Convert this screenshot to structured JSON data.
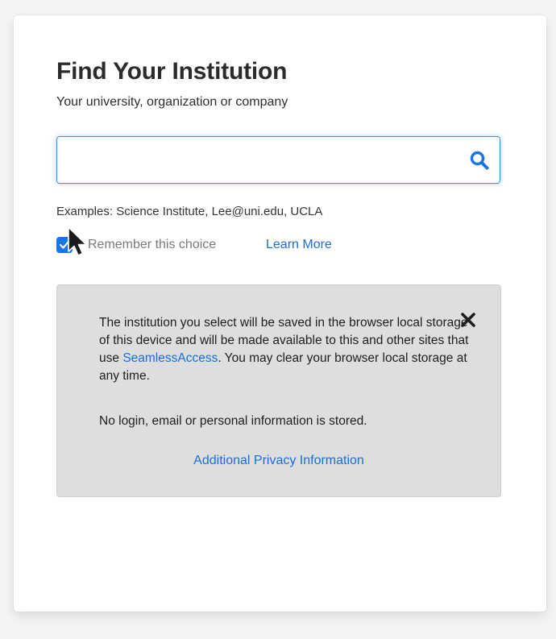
{
  "header": {
    "title": "Find Your Institution",
    "subtitle": "Your university, organization or company"
  },
  "search": {
    "value": "",
    "placeholder": "",
    "icon": "search-icon"
  },
  "examples": "Examples: Science Institute, Lee@uni.edu, UCLA",
  "remember": {
    "label": "Remember this choice",
    "checked": true,
    "learn_more": "Learn More"
  },
  "info_panel": {
    "text_before_link": "The institution you select will be saved in the browser local storage of this device and will be made available to this and other sites that use ",
    "link_text": "SeamlessAccess",
    "text_after_link": ". You may clear your browser local storage at any time.",
    "secondary_text": "No login, email or personal information is stored.",
    "privacy_link": "Additional Privacy Information",
    "close_icon": "close-icon"
  },
  "colors": {
    "accent": "#1a6ed8",
    "checkbox": "#1a73e8",
    "panel_bg": "#dedede",
    "focus_border": "#3d8fe6"
  }
}
